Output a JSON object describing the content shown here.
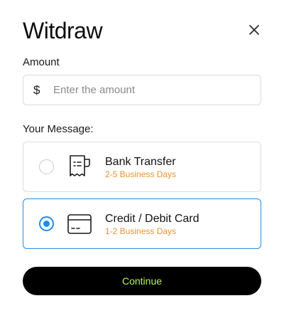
{
  "dialog": {
    "title": "Witdraw",
    "close_icon": "close-icon"
  },
  "amount": {
    "label": "Amount",
    "currency_symbol": "$",
    "value": "",
    "placeholder": "Enter the amount"
  },
  "message": {
    "label": "Your Message:"
  },
  "options": [
    {
      "title": "Bank Transfer",
      "subtitle": "2-5 Business Days",
      "icon": "receipt-icon",
      "selected": false
    },
    {
      "title": "Credit / Debit Card",
      "subtitle": "1-2 Business Days",
      "icon": "credit-card-icon",
      "selected": true
    }
  ],
  "actions": {
    "continue_label": "Continue"
  },
  "colors": {
    "accent": "#1f8ceb",
    "subtitle": "#e8942e",
    "button_bg": "#000000",
    "button_text": "#b9f35b",
    "border": "#dcdcdc"
  }
}
